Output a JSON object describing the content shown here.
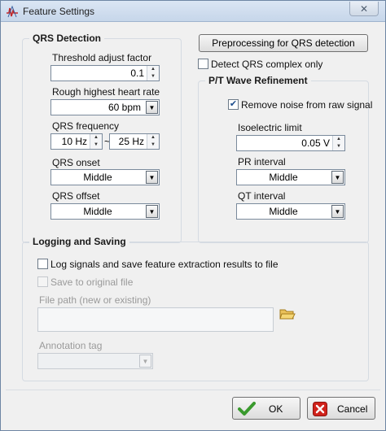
{
  "window": {
    "title": "Feature Settings",
    "close_glyph": "✕"
  },
  "qrs": {
    "title": "QRS Detection",
    "threshold_label": "Threshold adjust factor",
    "threshold_value": "0.1",
    "rough_hr_label": "Rough highest heart rate",
    "rough_hr_value": "60 bpm",
    "freq_label": "QRS frequency",
    "freq_low": "10 Hz",
    "freq_sep": "~",
    "freq_high": "25 Hz",
    "onset_label": "QRS onset",
    "onset_value": "Middle",
    "offset_label": "QRS offset",
    "offset_value": "Middle"
  },
  "preprocessing_button": "Preprocessing for QRS detection",
  "detect_only_label": "Detect QRS complex only",
  "pt": {
    "title": "P/T Wave Refinement",
    "remove_noise_label": "Remove noise from raw signal",
    "isoelectric_label": "Isoelectric limit",
    "isoelectric_value": "0.05 V",
    "pr_label": "PR interval",
    "pr_value": "Middle",
    "qt_label": "QT interval",
    "qt_value": "Middle"
  },
  "logging": {
    "title": "Logging and Saving",
    "log_label": "Log signals and save feature extraction results to file",
    "save_original_label": "Save to original file",
    "file_path_label": "File path (new or existing)",
    "annotation_label": "Annotation tag"
  },
  "buttons": {
    "ok": "OK",
    "cancel": "Cancel"
  },
  "colors": {
    "ok_check": "#3a9a2e",
    "cancel_x": "#d0221b",
    "folder": "#e7b93c"
  }
}
